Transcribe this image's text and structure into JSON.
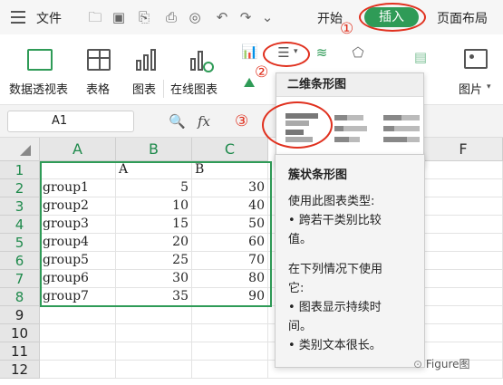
{
  "menubar": {
    "file": "文件",
    "start": "开始",
    "insert": "插入",
    "page_layout": "页面布局"
  },
  "ribbon": {
    "pivot": "数据透视表",
    "table": "表格",
    "chart": "图表",
    "online_chart": "在线图表",
    "picture": "图片"
  },
  "formula_bar": {
    "cell_ref": "A1",
    "fx": "fx"
  },
  "annotations": [
    "①",
    "②",
    "③"
  ],
  "grid": {
    "columns": [
      "A",
      "B",
      "C",
      "F"
    ],
    "rows": [
      "1",
      "2",
      "3",
      "4",
      "5",
      "6",
      "7",
      "8",
      "9",
      "10",
      "11",
      "12"
    ],
    "data": [
      [
        "",
        "A",
        "B"
      ],
      [
        "group1",
        "5",
        "30"
      ],
      [
        "group2",
        "10",
        "40"
      ],
      [
        "group3",
        "15",
        "50"
      ],
      [
        "group4",
        "20",
        "60"
      ],
      [
        "group5",
        "25",
        "70"
      ],
      [
        "group6",
        "30",
        "80"
      ],
      [
        "group7",
        "35",
        "90"
      ]
    ]
  },
  "dropdown": {
    "header": "二维条形图"
  },
  "tooltip": {
    "title": "簇状条形图",
    "lines": [
      "使用此图表类型:",
      "• 跨若干类别比较",
      "值。",
      "",
      "在下列情况下使用",
      "它:",
      "• 图表显示持续时",
      "间。",
      "• 类别文本很长。"
    ]
  },
  "watermark": "Figure图"
}
